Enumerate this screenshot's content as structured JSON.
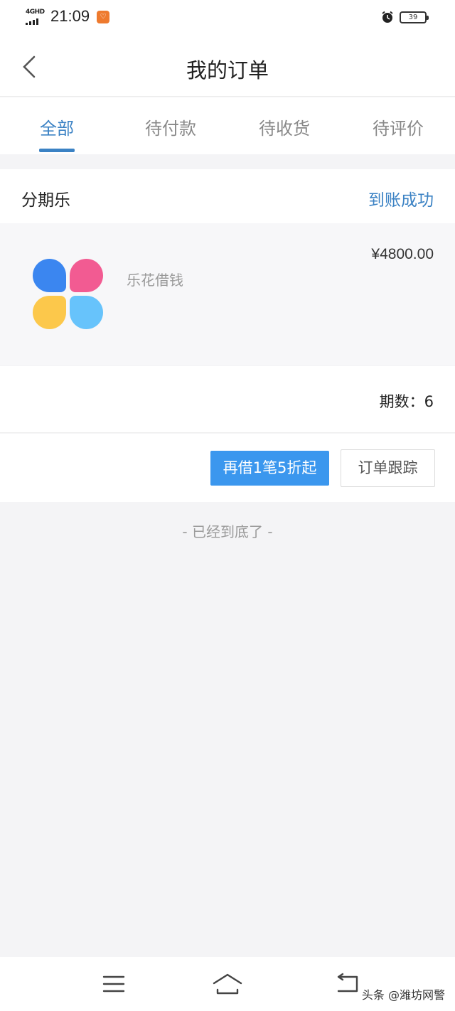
{
  "status_bar": {
    "network": "4GHD",
    "time": "21:09",
    "app_badge": "♡",
    "battery": "39"
  },
  "header": {
    "title": "我的订单"
  },
  "tabs": [
    {
      "label": "全部",
      "active": true
    },
    {
      "label": "待付款",
      "active": false
    },
    {
      "label": "待收货",
      "active": false
    },
    {
      "label": "待评价",
      "active": false
    }
  ],
  "order": {
    "shop_name": "分期乐",
    "status": "到账成功",
    "product_name": "乐花借钱",
    "price": "¥4800.00",
    "periods_label": "期数：6",
    "primary_action": "再借1笔5折起",
    "secondary_action": "订单跟踪"
  },
  "footer": {
    "end_text": "- 已经到底了 -"
  },
  "watermark": "头条 @潍坊网警",
  "colors": {
    "accent": "#3b82c4",
    "button_blue": "#3b97ee",
    "background": "#f4f4f6"
  },
  "icons": {
    "back": "chevron-left-icon",
    "alarm": "alarm-icon",
    "menu": "menu-icon",
    "home": "home-icon",
    "return": "return-icon"
  }
}
